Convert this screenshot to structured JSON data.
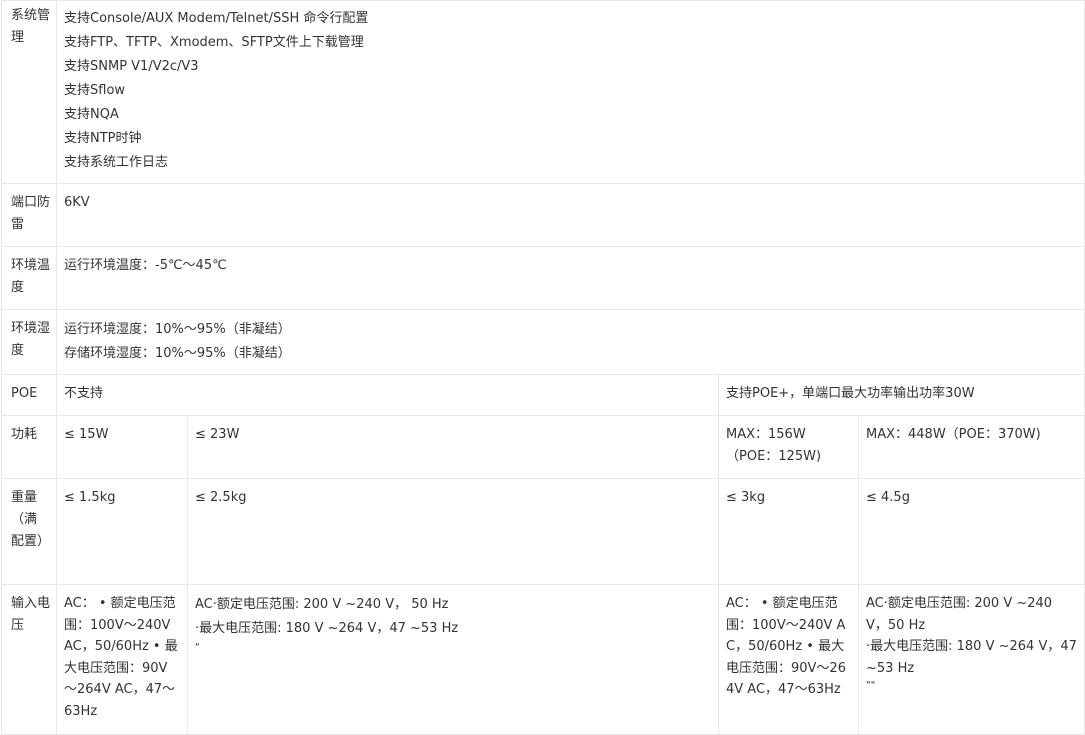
{
  "rows": {
    "management": {
      "label": "系统管理",
      "items": [
        "支持Console/AUX Modem/Telnet/SSH 命令行配置",
        "支持FTP、TFTP、Xmodem、SFTP文件上下载管理",
        "支持SNMP V1/V2c/V3",
        "支持Sflow",
        "支持NQA",
        "支持NTP时钟",
        "支持系统工作日志"
      ]
    },
    "lightning": {
      "label": "端口防雷",
      "value": "6KV"
    },
    "temperature": {
      "label": "环境温度",
      "value": "运行环境温度：-5℃～45℃"
    },
    "humidity": {
      "label": "环境湿度",
      "operating": "运行环境湿度：10%～95%（非凝结）",
      "storage": "存储环境湿度：10%～95%（非凝结）"
    },
    "poe": {
      "label": "POE",
      "unsupported": "不支持",
      "supported": "支持POE+，单端口最大功率输出功率30W"
    },
    "power": {
      "label": "功耗",
      "col1": "≤ 15W",
      "col2": "≤ 23W",
      "col3_line1": "MAX：156W",
      "col3_line2": "（POE：125W)",
      "col4": "MAX：448W（POE：370W)"
    },
    "weight": {
      "label": "重量（满配置）",
      "col1": "≤ 1.5kg",
      "col2": "≤ 2.5kg",
      "col3": "≤ 3kg",
      "col4": "≤ 4.5g"
    },
    "input": {
      "label": "输入电压",
      "col1": "AC： • 额定电压范围：100V～240V AC，50/60Hz • 最大电压范围：90V～264V AC，47～63Hz",
      "col2_line1": "AC·额定电压范围: 200 V ~240 V， 50 Hz",
      "col2_line2": "·最大电压范围: 180 V ~264 V，47 ~53 Hz",
      "col2_line3": "\"",
      "col3": "AC： • 额定电压范围：100V～240V AC，50/60Hz • 最大电压范围：90V～264V AC，47～63Hz",
      "col4_line1": "AC·额定电压范围: 200 V ~240 V，50 Hz",
      "col4_line2": "·最大电压范围: 180 V ~264 V，47 ~53 Hz",
      "col4_line3": "\"\""
    }
  }
}
